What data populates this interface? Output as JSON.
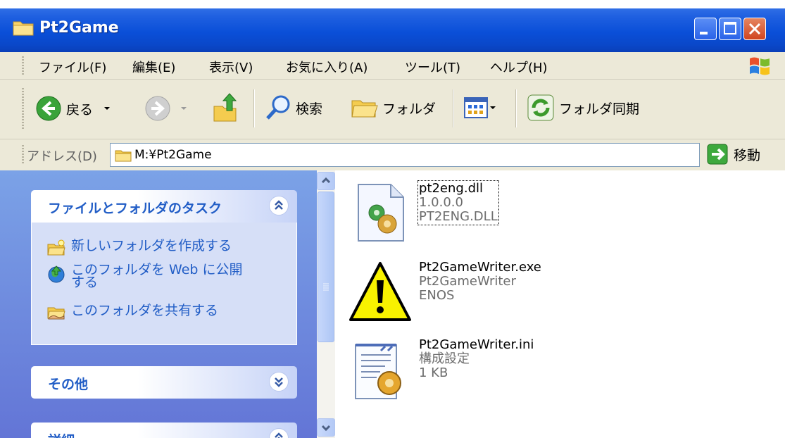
{
  "window": {
    "title": "Pt2Game"
  },
  "menu": {
    "items": [
      "ファイル(F)",
      "編集(E)",
      "表示(V)",
      "お気に入り(A)",
      "ツール(T)",
      "ヘルプ(H)"
    ]
  },
  "toolbar": {
    "back_label": "戻る",
    "search_label": "検索",
    "folders_label": "フォルダ",
    "sync_label": "フォルダ同期"
  },
  "address": {
    "label": "アドレス(D)",
    "value": "M:¥Pt2Game",
    "go_label": "移動"
  },
  "taskpane": {
    "file_tasks": {
      "title": "ファイルとフォルダのタスク",
      "items": [
        {
          "label": "新しいフォルダを作成する",
          "icon": "new-folder-icon"
        },
        {
          "label_line1": "このフォルダを Web に公開",
          "label_line2": "する",
          "icon": "publish-web-icon"
        },
        {
          "label": "このフォルダを共有する",
          "icon": "share-folder-icon"
        }
      ]
    },
    "other": {
      "title": "その他"
    },
    "details": {
      "title": "詳細"
    }
  },
  "files": [
    {
      "name": "pt2eng.dll",
      "line2": "1.0.0.0",
      "line3": "PT2ENG.DLL",
      "icon": "dll-file-icon",
      "selected": true
    },
    {
      "name": "Pt2GameWriter.exe",
      "line2": "Pt2GameWriter",
      "line3": "ENOS",
      "icon": "warning-icon"
    },
    {
      "name": "Pt2GameWriter.ini",
      "line2": "構成設定",
      "line3": "1 KB",
      "icon": "ini-file-icon"
    }
  ],
  "colors": {
    "titlebar": "#0a4fd8",
    "taskpane_gradient_top": "#7ba2e7",
    "taskpane_link": "#215dc6",
    "chrome": "#ece9d8"
  }
}
